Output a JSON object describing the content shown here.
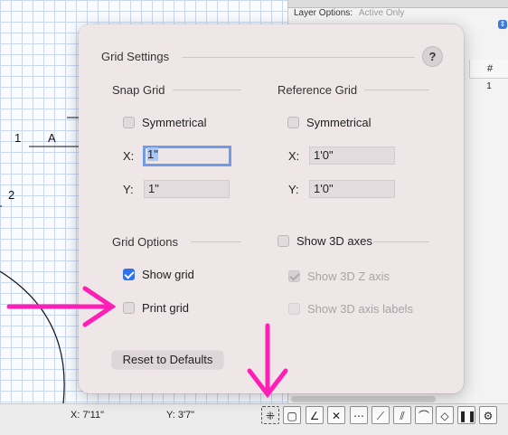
{
  "canvas": {
    "row_label_1": "1",
    "col_label_a": "A",
    "row_label_2": "2"
  },
  "right_panel": {
    "layer_options_label": "Layer Options:",
    "layer_options_value": "Active Only",
    "table_header": "#",
    "table_value": "1"
  },
  "dialog": {
    "title": "Grid Settings",
    "help_label": "?",
    "snap_grid": {
      "title": "Snap Grid",
      "symmetrical_label": "Symmetrical",
      "symmetrical_checked": false,
      "x_label": "X:",
      "x_value": "1\"",
      "y_label": "Y:",
      "y_value": "1\""
    },
    "reference_grid": {
      "title": "Reference Grid",
      "symmetrical_label": "Symmetrical",
      "symmetrical_checked": false,
      "x_label": "X:",
      "x_value": "1'0\"",
      "y_label": "Y:",
      "y_value": "1'0\""
    },
    "grid_options": {
      "title": "Grid Options",
      "show_grid_label": "Show grid",
      "show_grid_checked": true,
      "print_grid_label": "Print grid",
      "print_grid_checked": false
    },
    "axes": {
      "show_3d_axes_label": "Show 3D axes",
      "show_3d_axes_checked": false,
      "show_3d_z_axis_label": "Show 3D Z axis",
      "show_3d_z_axis_checked": true,
      "show_3d_axis_labels_label": "Show 3D axis labels",
      "show_3d_axis_labels_checked": false
    },
    "reset_button": "Reset to Defaults"
  },
  "statusbar": {
    "x_coord": "X: 7'11\"",
    "y_coord": "Y: 3'7\""
  },
  "toolbar_icons": [
    "grid-snap-icon",
    "snap-box-icon",
    "snap-angle-icon",
    "snap-intersection-icon",
    "snap-distance-icon",
    "snap-point-icon",
    "snap-tangent-icon",
    "snap-arc-icon",
    "snap-surface-icon",
    "pause-icon",
    "gear-icon"
  ],
  "colors": {
    "annotation": "#ff1fb4",
    "accent": "#2f6ff0",
    "dialog_bg": "#efe6e8"
  }
}
